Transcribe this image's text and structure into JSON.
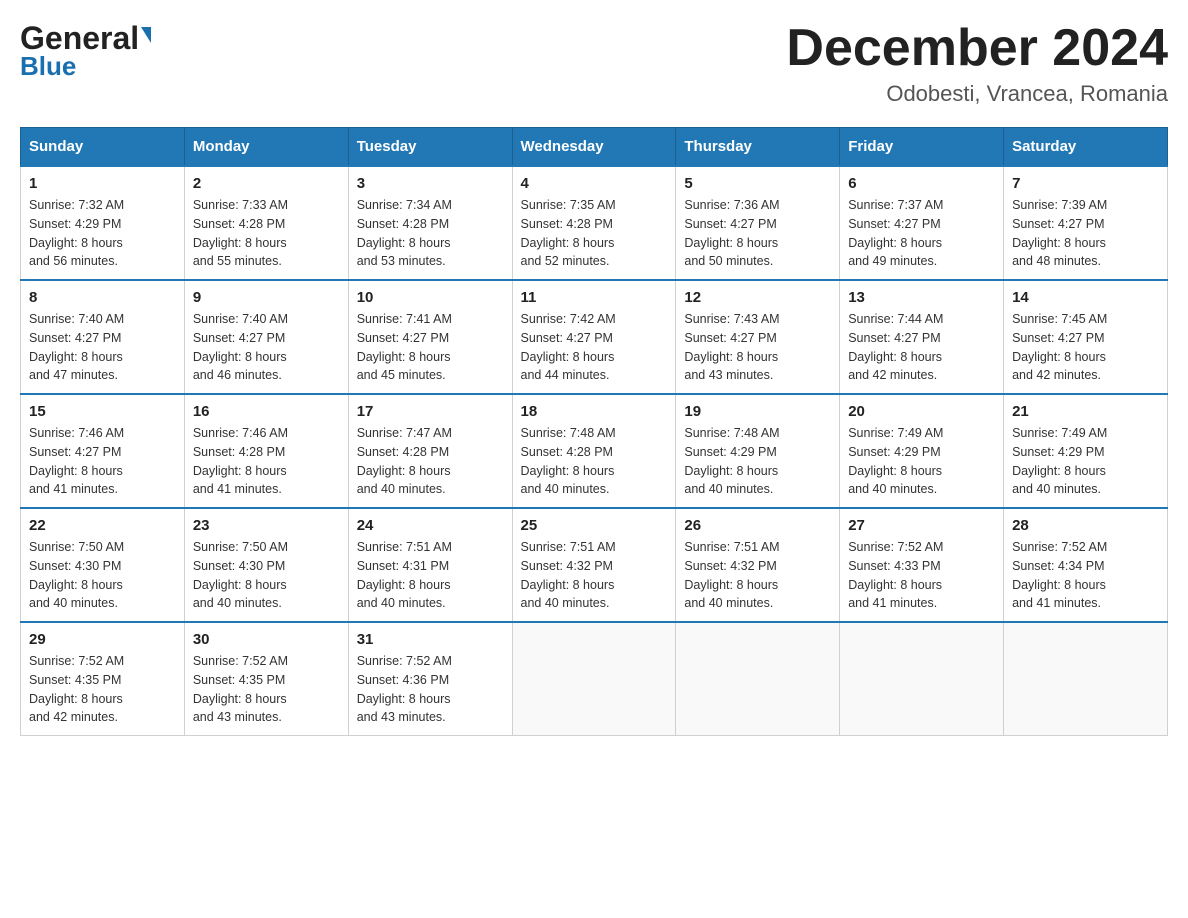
{
  "header": {
    "month_title": "December 2024",
    "location": "Odobesti, Vrancea, Romania",
    "logo_general": "General",
    "logo_blue": "Blue"
  },
  "weekdays": [
    "Sunday",
    "Monday",
    "Tuesday",
    "Wednesday",
    "Thursday",
    "Friday",
    "Saturday"
  ],
  "weeks": [
    [
      {
        "day": "1",
        "sunrise": "Sunrise: 7:32 AM",
        "sunset": "Sunset: 4:29 PM",
        "daylight": "Daylight: 8 hours",
        "daylight2": "and 56 minutes."
      },
      {
        "day": "2",
        "sunrise": "Sunrise: 7:33 AM",
        "sunset": "Sunset: 4:28 PM",
        "daylight": "Daylight: 8 hours",
        "daylight2": "and 55 minutes."
      },
      {
        "day": "3",
        "sunrise": "Sunrise: 7:34 AM",
        "sunset": "Sunset: 4:28 PM",
        "daylight": "Daylight: 8 hours",
        "daylight2": "and 53 minutes."
      },
      {
        "day": "4",
        "sunrise": "Sunrise: 7:35 AM",
        "sunset": "Sunset: 4:28 PM",
        "daylight": "Daylight: 8 hours",
        "daylight2": "and 52 minutes."
      },
      {
        "day": "5",
        "sunrise": "Sunrise: 7:36 AM",
        "sunset": "Sunset: 4:27 PM",
        "daylight": "Daylight: 8 hours",
        "daylight2": "and 50 minutes."
      },
      {
        "day": "6",
        "sunrise": "Sunrise: 7:37 AM",
        "sunset": "Sunset: 4:27 PM",
        "daylight": "Daylight: 8 hours",
        "daylight2": "and 49 minutes."
      },
      {
        "day": "7",
        "sunrise": "Sunrise: 7:39 AM",
        "sunset": "Sunset: 4:27 PM",
        "daylight": "Daylight: 8 hours",
        "daylight2": "and 48 minutes."
      }
    ],
    [
      {
        "day": "8",
        "sunrise": "Sunrise: 7:40 AM",
        "sunset": "Sunset: 4:27 PM",
        "daylight": "Daylight: 8 hours",
        "daylight2": "and 47 minutes."
      },
      {
        "day": "9",
        "sunrise": "Sunrise: 7:40 AM",
        "sunset": "Sunset: 4:27 PM",
        "daylight": "Daylight: 8 hours",
        "daylight2": "and 46 minutes."
      },
      {
        "day": "10",
        "sunrise": "Sunrise: 7:41 AM",
        "sunset": "Sunset: 4:27 PM",
        "daylight": "Daylight: 8 hours",
        "daylight2": "and 45 minutes."
      },
      {
        "day": "11",
        "sunrise": "Sunrise: 7:42 AM",
        "sunset": "Sunset: 4:27 PM",
        "daylight": "Daylight: 8 hours",
        "daylight2": "and 44 minutes."
      },
      {
        "day": "12",
        "sunrise": "Sunrise: 7:43 AM",
        "sunset": "Sunset: 4:27 PM",
        "daylight": "Daylight: 8 hours",
        "daylight2": "and 43 minutes."
      },
      {
        "day": "13",
        "sunrise": "Sunrise: 7:44 AM",
        "sunset": "Sunset: 4:27 PM",
        "daylight": "Daylight: 8 hours",
        "daylight2": "and 42 minutes."
      },
      {
        "day": "14",
        "sunrise": "Sunrise: 7:45 AM",
        "sunset": "Sunset: 4:27 PM",
        "daylight": "Daylight: 8 hours",
        "daylight2": "and 42 minutes."
      }
    ],
    [
      {
        "day": "15",
        "sunrise": "Sunrise: 7:46 AM",
        "sunset": "Sunset: 4:27 PM",
        "daylight": "Daylight: 8 hours",
        "daylight2": "and 41 minutes."
      },
      {
        "day": "16",
        "sunrise": "Sunrise: 7:46 AM",
        "sunset": "Sunset: 4:28 PM",
        "daylight": "Daylight: 8 hours",
        "daylight2": "and 41 minutes."
      },
      {
        "day": "17",
        "sunrise": "Sunrise: 7:47 AM",
        "sunset": "Sunset: 4:28 PM",
        "daylight": "Daylight: 8 hours",
        "daylight2": "and 40 minutes."
      },
      {
        "day": "18",
        "sunrise": "Sunrise: 7:48 AM",
        "sunset": "Sunset: 4:28 PM",
        "daylight": "Daylight: 8 hours",
        "daylight2": "and 40 minutes."
      },
      {
        "day": "19",
        "sunrise": "Sunrise: 7:48 AM",
        "sunset": "Sunset: 4:29 PM",
        "daylight": "Daylight: 8 hours",
        "daylight2": "and 40 minutes."
      },
      {
        "day": "20",
        "sunrise": "Sunrise: 7:49 AM",
        "sunset": "Sunset: 4:29 PM",
        "daylight": "Daylight: 8 hours",
        "daylight2": "and 40 minutes."
      },
      {
        "day": "21",
        "sunrise": "Sunrise: 7:49 AM",
        "sunset": "Sunset: 4:29 PM",
        "daylight": "Daylight: 8 hours",
        "daylight2": "and 40 minutes."
      }
    ],
    [
      {
        "day": "22",
        "sunrise": "Sunrise: 7:50 AM",
        "sunset": "Sunset: 4:30 PM",
        "daylight": "Daylight: 8 hours",
        "daylight2": "and 40 minutes."
      },
      {
        "day": "23",
        "sunrise": "Sunrise: 7:50 AM",
        "sunset": "Sunset: 4:30 PM",
        "daylight": "Daylight: 8 hours",
        "daylight2": "and 40 minutes."
      },
      {
        "day": "24",
        "sunrise": "Sunrise: 7:51 AM",
        "sunset": "Sunset: 4:31 PM",
        "daylight": "Daylight: 8 hours",
        "daylight2": "and 40 minutes."
      },
      {
        "day": "25",
        "sunrise": "Sunrise: 7:51 AM",
        "sunset": "Sunset: 4:32 PM",
        "daylight": "Daylight: 8 hours",
        "daylight2": "and 40 minutes."
      },
      {
        "day": "26",
        "sunrise": "Sunrise: 7:51 AM",
        "sunset": "Sunset: 4:32 PM",
        "daylight": "Daylight: 8 hours",
        "daylight2": "and 40 minutes."
      },
      {
        "day": "27",
        "sunrise": "Sunrise: 7:52 AM",
        "sunset": "Sunset: 4:33 PM",
        "daylight": "Daylight: 8 hours",
        "daylight2": "and 41 minutes."
      },
      {
        "day": "28",
        "sunrise": "Sunrise: 7:52 AM",
        "sunset": "Sunset: 4:34 PM",
        "daylight": "Daylight: 8 hours",
        "daylight2": "and 41 minutes."
      }
    ],
    [
      {
        "day": "29",
        "sunrise": "Sunrise: 7:52 AM",
        "sunset": "Sunset: 4:35 PM",
        "daylight": "Daylight: 8 hours",
        "daylight2": "and 42 minutes."
      },
      {
        "day": "30",
        "sunrise": "Sunrise: 7:52 AM",
        "sunset": "Sunset: 4:35 PM",
        "daylight": "Daylight: 8 hours",
        "daylight2": "and 43 minutes."
      },
      {
        "day": "31",
        "sunrise": "Sunrise: 7:52 AM",
        "sunset": "Sunset: 4:36 PM",
        "daylight": "Daylight: 8 hours",
        "daylight2": "and 43 minutes."
      },
      null,
      null,
      null,
      null
    ]
  ]
}
